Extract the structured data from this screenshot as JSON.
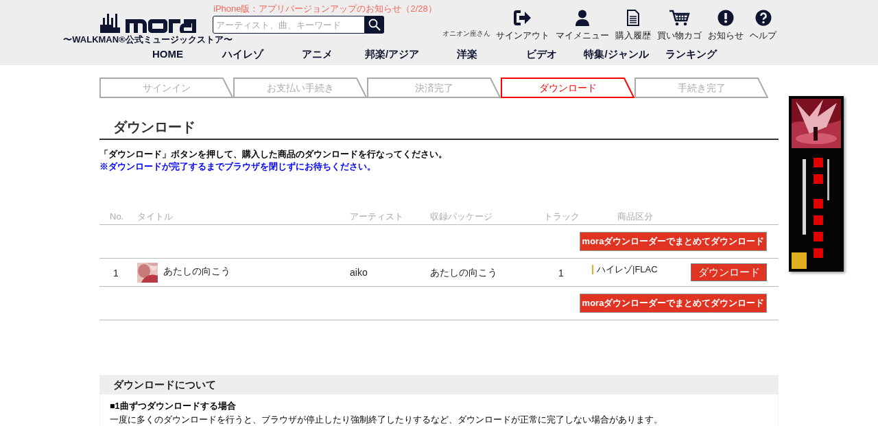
{
  "header": {
    "logo_tagline": "〜WALKMAN®公式ミュージックストア〜",
    "notice": "iPhone版：アプリバージョンアップのお知らせ（2/28）",
    "search": {
      "placeholder": "アーティスト、曲、キーワード"
    },
    "user": "オニオン座さん",
    "links": [
      {
        "kind": "signout",
        "label": "サインアウト"
      },
      {
        "kind": "user",
        "label": "マイメニュー"
      },
      {
        "kind": "history",
        "label": "購入履歴"
      },
      {
        "kind": "cart",
        "label": "買い物カゴ"
      },
      {
        "kind": "info",
        "label": "お知らせ"
      },
      {
        "kind": "help",
        "label": "ヘルプ"
      }
    ],
    "nav": [
      "HOME",
      "ハイレゾ",
      "アニメ",
      "邦楽/アジア",
      "洋楽",
      "ビデオ",
      "特集/ジャンル",
      "ランキング"
    ]
  },
  "steps": [
    {
      "label": "サインイン",
      "selected": false
    },
    {
      "label": "お支払い手続き",
      "selected": false
    },
    {
      "label": "決済完了",
      "selected": false
    },
    {
      "label": "ダウンロード",
      "selected": true
    },
    {
      "label": "手続き完了",
      "selected": false
    }
  ],
  "heading": "ダウンロード",
  "instructions": [
    "「ダウンロード」ボタンを押して、購入した商品のダウンロードを行なってください。",
    "※ダウンロードが完了するまでブラウザを閉じずにお待ちください。"
  ],
  "table": {
    "columns": [
      "No.",
      "タイトル",
      "アーティスト",
      "収録パッケージ",
      "トラック",
      "商品区分"
    ],
    "bulk_button": "moraダウンローダーでまとめてダウンロード",
    "rows": [
      {
        "no": "1",
        "title": "あたしの向こう",
        "artist": "aiko",
        "package": "あたしの向こう",
        "track": "1",
        "category": "ハイレゾ|FLAC",
        "button": "ダウンロード"
      }
    ],
    "bulk_button_bottom": "moraダウンローダーでまとめてダウンロード"
  },
  "about": {
    "title": "ダウンロードについて",
    "subtitle": "■1曲ずつダウンロードする場合",
    "text": "一度に多くのダウンロードを行うと、ブラウザが停止したり強制終了したりするなど、ダウンロードが正常に完了しない場合があります。"
  }
}
